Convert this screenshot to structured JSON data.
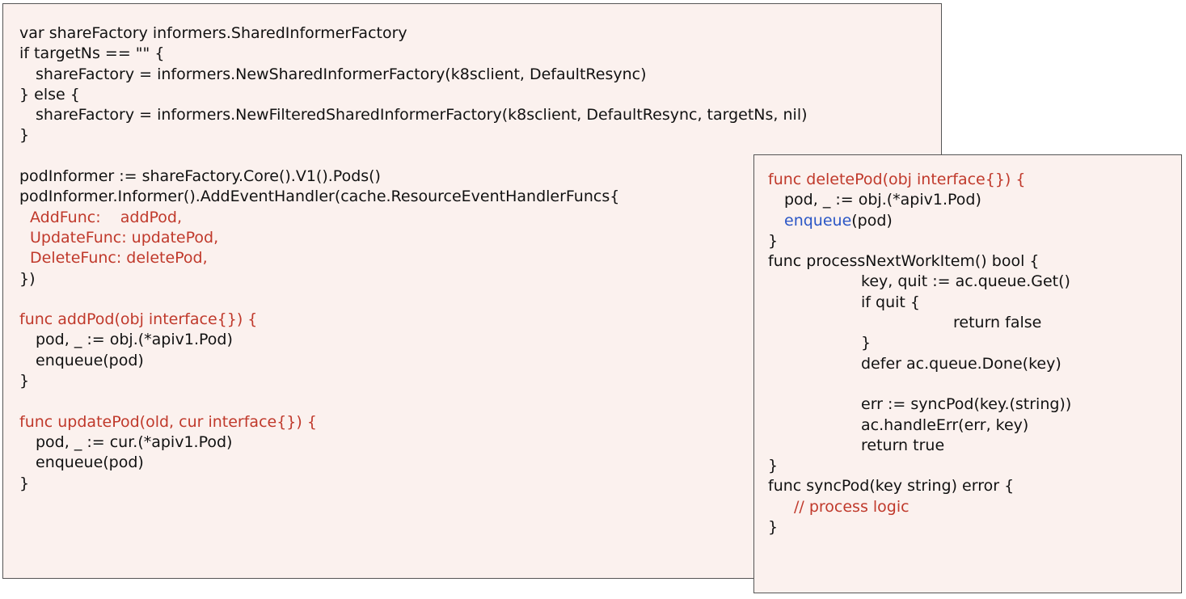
{
  "left_panel": {
    "lines": [
      "var shareFactory informers.SharedInformerFactory",
      "if targetNs == \"\" {",
      "shareFactory = informers.NewSharedInformerFactory(k8sclient, DefaultResync)",
      "} else {",
      "shareFactory = informers.NewFilteredSharedInformerFactory(k8sclient, DefaultResync, targetNs, nil)",
      "}",
      "",
      "podInformer := shareFactory.Core().V1().Pods()",
      "podInformer.Informer().AddEventHandler(cache.ResourceEventHandlerFuncs{",
      "AddFunc:    addPod,",
      "UpdateFunc: updatePod,",
      "DeleteFunc: deletePod,",
      "})",
      "",
      "func addPod(obj interface{}) {",
      "pod, _ := obj.(*apiv1.Pod)",
      "enqueue(pod)",
      "}",
      "",
      "func updatePod(old, cur interface{}) {",
      "pod, _ := cur.(*apiv1.Pod)",
      "enqueue(pod)",
      "}"
    ]
  },
  "right_panel": {
    "lines": [
      "func deletePod(obj interface{}) {",
      "pod, _ := obj.(*apiv1.Pod)",
      "enqueue",
      "(pod)",
      "}",
      "func processNextWorkItem() bool {",
      "key, quit := ac.queue.Get()",
      "if quit {",
      "return false",
      "}",
      "defer ac.queue.Done(key)",
      "",
      "err := syncPod(key.(string))",
      "ac.handleErr(err, key)",
      "return true",
      "}",
      "func syncPod(key string) error {",
      "// process logic",
      "}"
    ]
  },
  "colors": {
    "panel_background": "#fbf1ee",
    "highlight_red": "#c0392b",
    "highlight_blue": "#2a56c6",
    "text": "#111111"
  }
}
